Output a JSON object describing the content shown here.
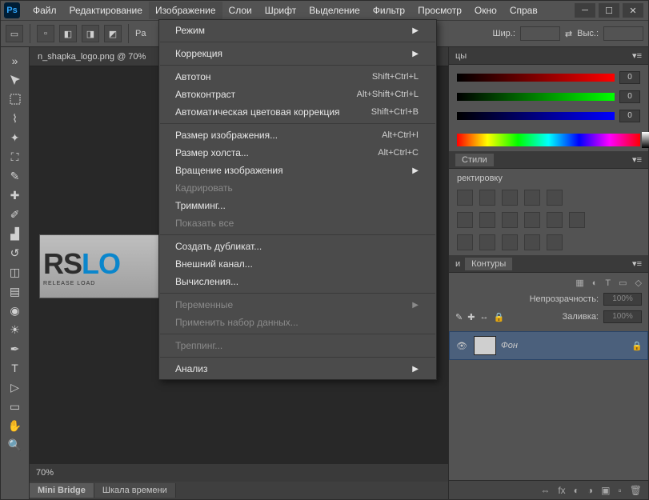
{
  "app": {
    "logo": "Ps"
  },
  "menubar": [
    "Файл",
    "Редактирование",
    "Изображение",
    "Слои",
    "Шрифт",
    "Выделение",
    "Фильтр",
    "Просмотр",
    "Окно",
    "Справ"
  ],
  "open_menu_index": 2,
  "doc_tab": "n_shapka_logo.png @ 70%",
  "zoom": "70%",
  "bottom_tabs": [
    "Mini Bridge",
    "Шкала времени"
  ],
  "optbar": {
    "width_label": "Шир.:",
    "height_label": "Выс.:",
    "width": "",
    "height": ""
  },
  "logo": {
    "rs": "RS",
    "lo": "LO",
    "sub": "RELEASE LOAD"
  },
  "dropdown": [
    {
      "label": "Режим",
      "sub": true
    },
    {
      "sep": true
    },
    {
      "label": "Коррекция",
      "sub": true
    },
    {
      "sep": true
    },
    {
      "label": "Автотон",
      "shortcut": "Shift+Ctrl+L"
    },
    {
      "label": "Автоконтраст",
      "shortcut": "Alt+Shift+Ctrl+L"
    },
    {
      "label": "Автоматическая цветовая коррекция",
      "shortcut": "Shift+Ctrl+B"
    },
    {
      "sep": true
    },
    {
      "label": "Размер изображения...",
      "shortcut": "Alt+Ctrl+I"
    },
    {
      "label": "Размер холста...",
      "shortcut": "Alt+Ctrl+C"
    },
    {
      "label": "Вращение изображения",
      "sub": true
    },
    {
      "label": "Кадрировать",
      "disabled": true
    },
    {
      "label": "Тримминг..."
    },
    {
      "label": "Показать все",
      "disabled": true
    },
    {
      "sep": true
    },
    {
      "label": "Создать дубликат..."
    },
    {
      "label": "Внешний канал..."
    },
    {
      "label": "Вычисления..."
    },
    {
      "sep": true
    },
    {
      "label": "Переменные",
      "sub": true,
      "disabled": true
    },
    {
      "label": "Применить набор данных...",
      "disabled": true
    },
    {
      "sep": true
    },
    {
      "label": "Треппинг...",
      "disabled": true
    },
    {
      "sep": true
    },
    {
      "label": "Анализ",
      "sub": true
    }
  ],
  "panels": {
    "color_tab": "цы",
    "sliders": [
      {
        "grad": "linear-gradient(90deg,#000,#f00)",
        "val": "0"
      },
      {
        "grad": "linear-gradient(90deg,#000,#0f0)",
        "val": "0"
      },
      {
        "grad": "linear-gradient(90deg,#000,#00f)",
        "val": "0"
      }
    ],
    "styles_tab": "Стили",
    "adjust_heading": "ректировку",
    "layers_tabs": [
      "и",
      "Контуры"
    ],
    "opacity_label": "Непрозрачность:",
    "opacity": "100%",
    "fill_label": "Заливка:",
    "fill": "100%",
    "lock_label": "",
    "layer_name": "Фон"
  }
}
